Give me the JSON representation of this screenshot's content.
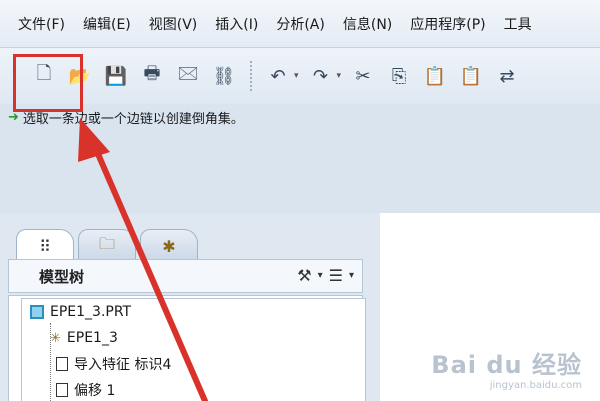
{
  "menu": {
    "items": [
      "文件(F)",
      "编辑(E)",
      "视图(V)",
      "插入(I)",
      "分析(A)",
      "信息(N)",
      "应用程序(P)",
      "工具"
    ]
  },
  "toolbar": {
    "buttons": [
      {
        "name": "new-icon",
        "glyph": "🗋"
      },
      {
        "name": "open-icon",
        "glyph": "📂"
      },
      {
        "name": "save-icon",
        "glyph": "💾"
      },
      {
        "name": "print-icon",
        "glyph": "🖶"
      },
      {
        "name": "send-icon",
        "glyph": "🖂"
      },
      {
        "name": "link-icon",
        "glyph": "⛓"
      }
    ],
    "undo_glyph": "↶",
    "redo_glyph": "↷",
    "dropdown_glyph": "▾",
    "edit_buttons": [
      {
        "name": "cut-icon",
        "glyph": "✂"
      },
      {
        "name": "copy-icon",
        "glyph": "⎘"
      },
      {
        "name": "paste-icon",
        "glyph": "📋"
      },
      {
        "name": "paste-special-icon",
        "glyph": "📋"
      },
      {
        "name": "regenerate-icon",
        "glyph": "⇄"
      }
    ]
  },
  "status": {
    "prefix": "选取",
    "message": "一条边或一个边链以创建倒角集。"
  },
  "model_tree": {
    "tabs": [
      "model-tree-tab",
      "folder-browser-tab",
      "favorites-tab"
    ],
    "title": "模型树",
    "items": [
      {
        "label": "EPE1_3.PRT",
        "icon": "part-icon"
      },
      {
        "label": "EPE1_3",
        "icon": "csys-icon"
      },
      {
        "label": "导入特征 标识4",
        "icon": "feature-icon"
      },
      {
        "label": "偏移 1",
        "icon": "feature-icon"
      }
    ]
  },
  "watermark": {
    "main": "Bai du 经验",
    "sub": "jingyan.baidu.com"
  },
  "colors": {
    "highlight": "#d9322b",
    "background": "#d9e4ef"
  }
}
